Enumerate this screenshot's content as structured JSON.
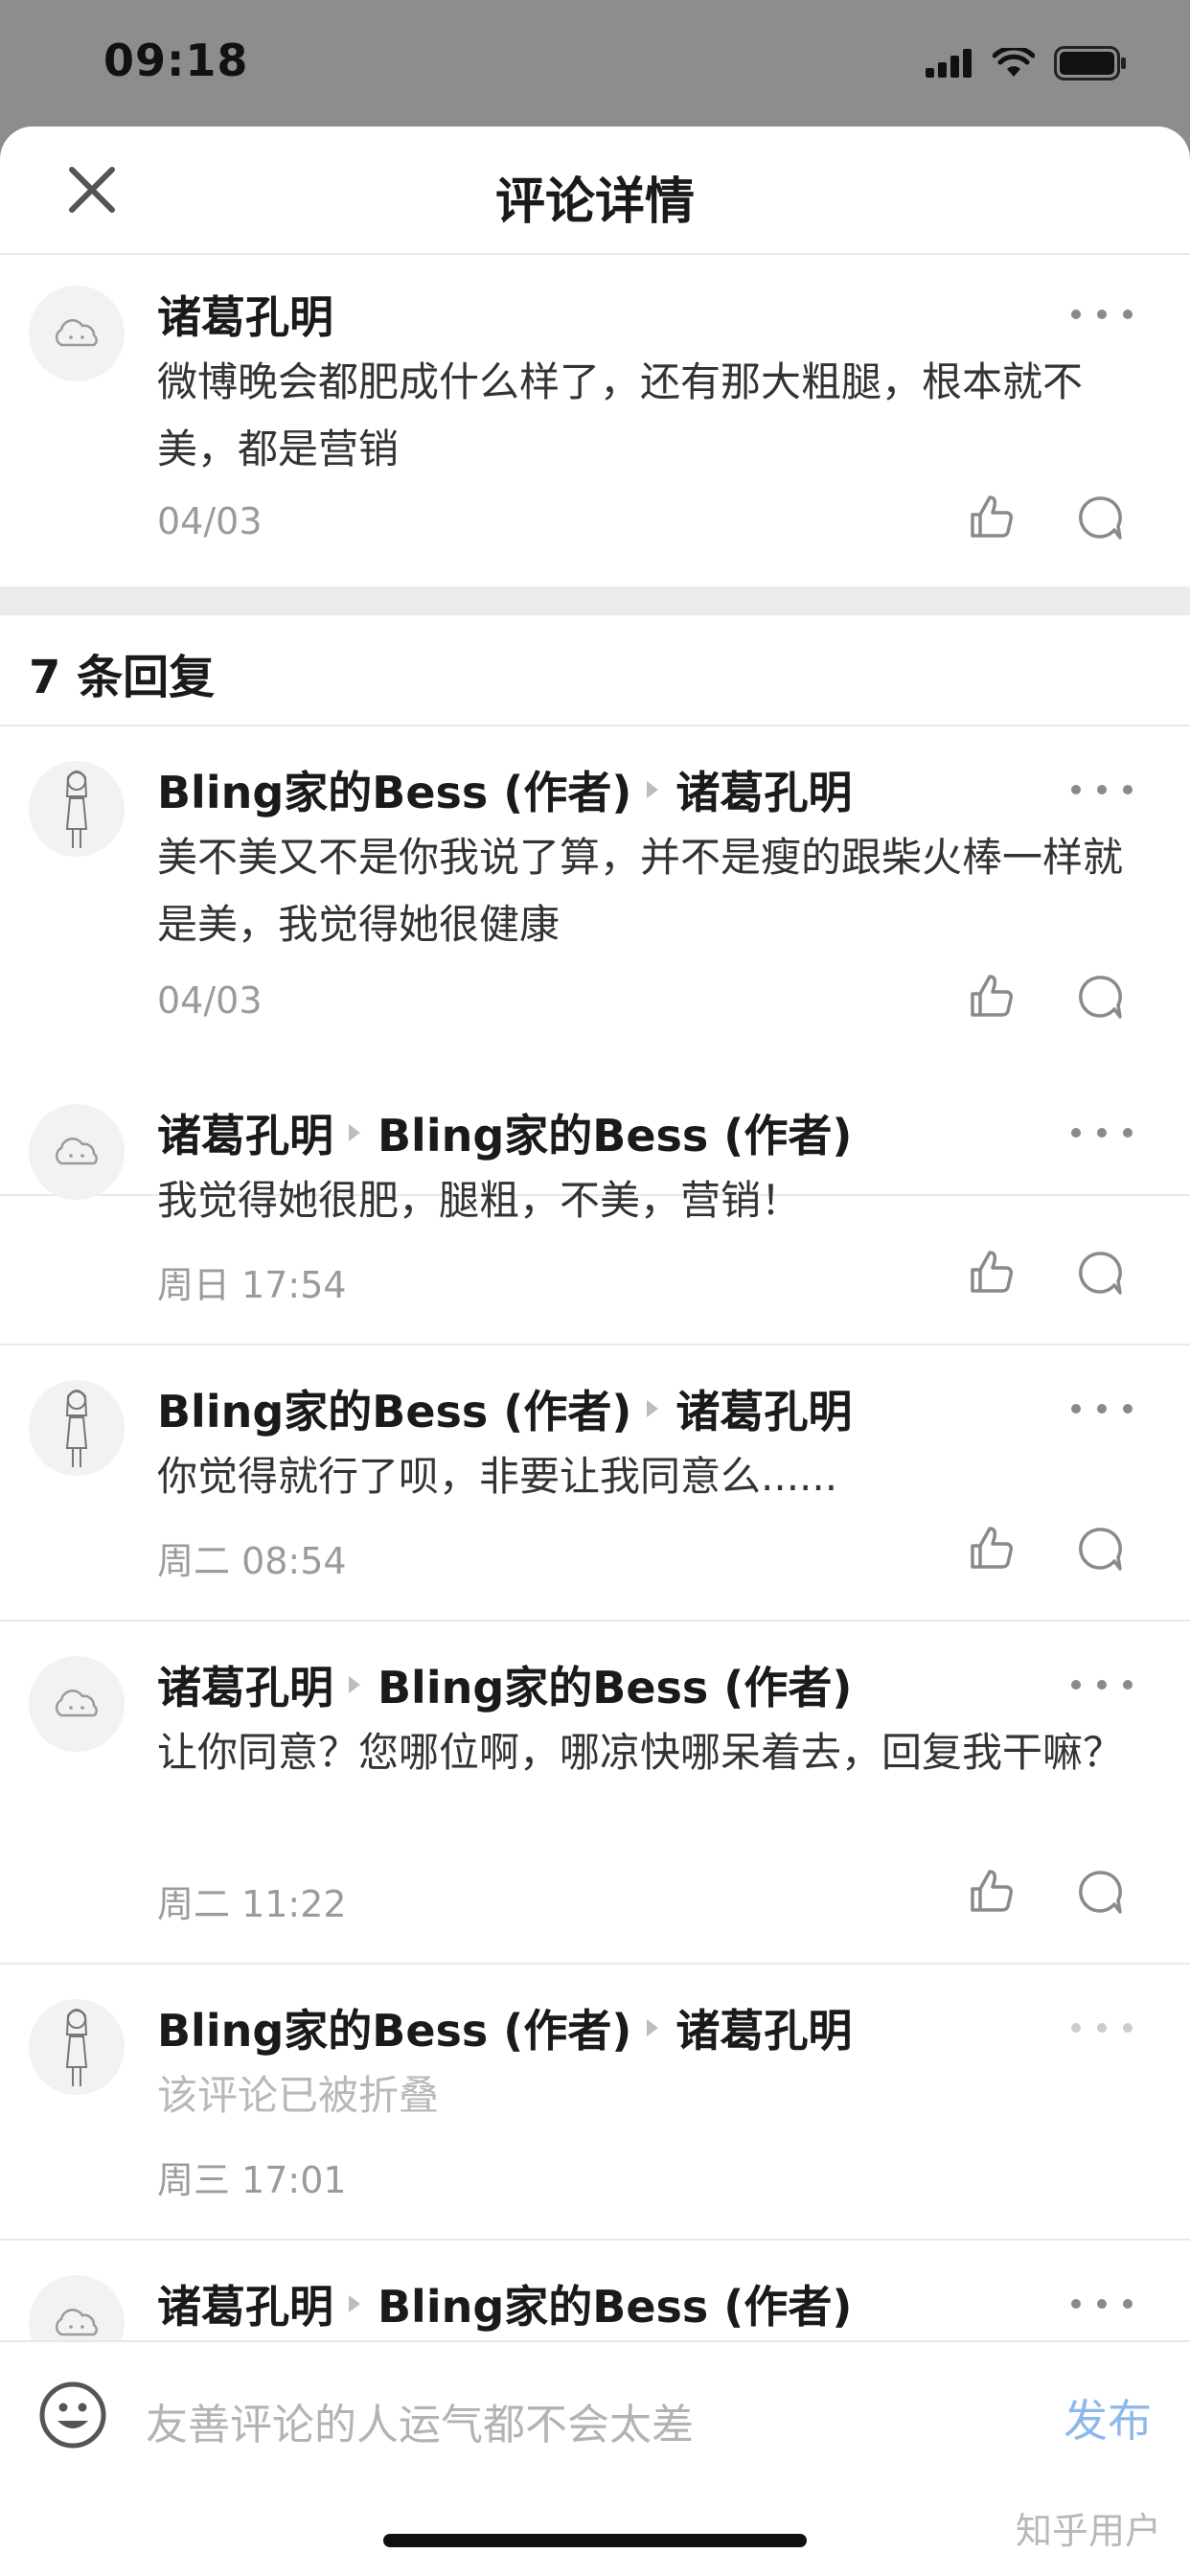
{
  "status": {
    "time": "09:18",
    "icons": [
      "signal-icon",
      "wifi-icon",
      "battery-icon"
    ]
  },
  "header": {
    "title": "评论详情",
    "close_icon": "close-icon"
  },
  "main_comment": {
    "author": "诸葛孔明",
    "text": "微博晚会都肥成什么样了，还有那大粗腿，根本就不美，都是营销",
    "time": "04/03"
  },
  "reply_count_label": "7 条回复",
  "replies": [
    {
      "author": "Bling家的Bess (作者)",
      "reply_to": "诸葛孔明",
      "text": "美不美又不是你我说了算，并不是瘦的跟柴火棒一样就是美，我觉得她很健康",
      "time": "04/03",
      "avatar": "girl"
    },
    {
      "author": "诸葛孔明",
      "reply_to": "Bling家的Bess (作者)",
      "text": "我觉得她很肥，腿粗，不美，营销！",
      "time": "周日 17:54",
      "avatar": "cloud"
    },
    {
      "author": "Bling家的Bess (作者)",
      "reply_to": "诸葛孔明",
      "text": "你觉得就行了呗，非要让我同意么......",
      "time": "周二 08:54",
      "avatar": "girl"
    },
    {
      "author": "诸葛孔明",
      "reply_to": "Bling家的Bess (作者)",
      "text": "让你同意？您哪位啊，哪凉快哪呆着去，回复我干嘛？",
      "time": "周二 11:22",
      "avatar": "cloud"
    },
    {
      "author": "Bling家的Bess (作者)",
      "reply_to": "诸葛孔明",
      "text": "该评论已被折叠",
      "time": "周三 17:01",
      "avatar": "girl",
      "folded": true
    },
    {
      "author": "诸葛孔明",
      "reply_to": "Bling家的Bess (作者)",
      "avatar": "cloud"
    }
  ],
  "input": {
    "placeholder": "友善评论的人运气都不会太差",
    "publish_label": "发布",
    "emoji_icon": "emoji-icon"
  },
  "watermark": "知乎用户",
  "colors": {
    "status_bar_bg": "#8d8d8d",
    "publish": "#8fb8ea",
    "secondary_text": "#9b9b9b",
    "folded_text": "#b8b8b8"
  }
}
